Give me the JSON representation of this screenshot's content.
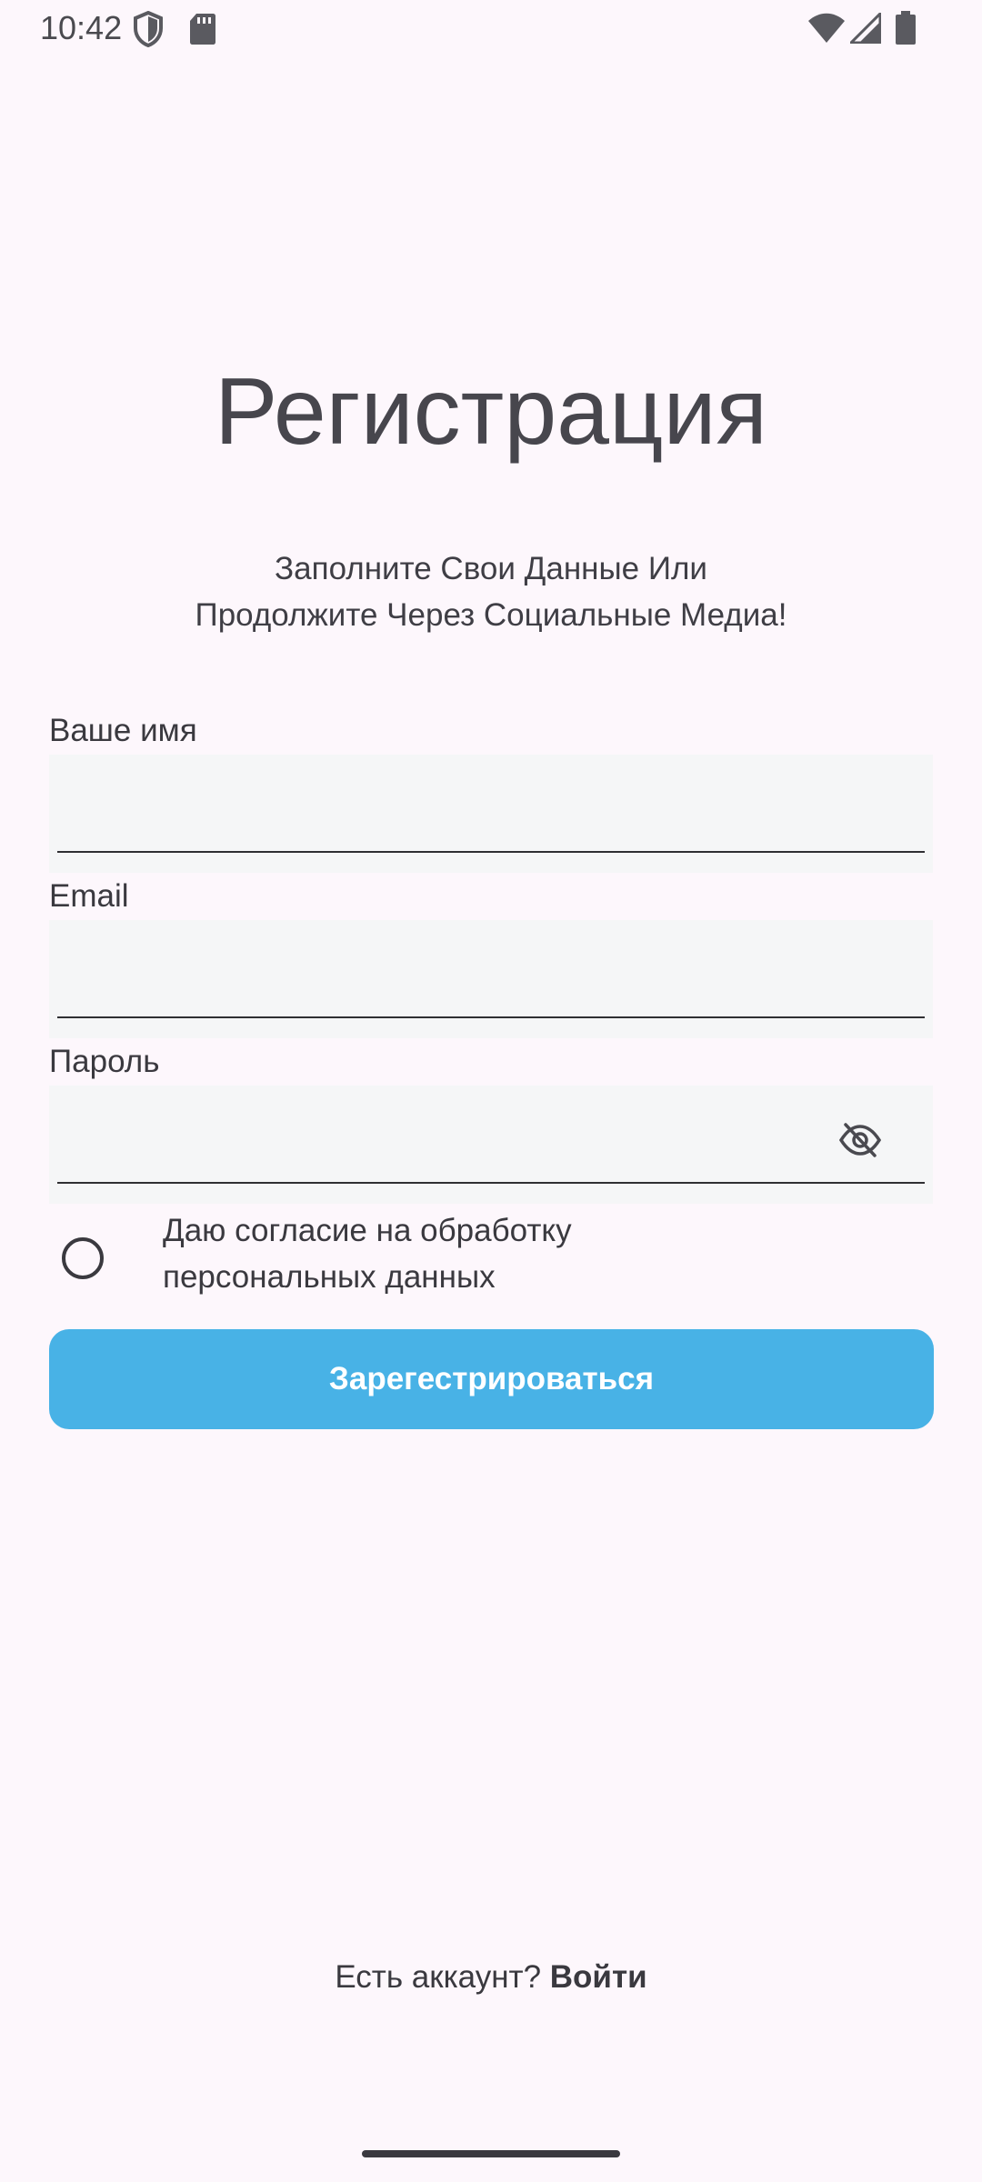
{
  "status_bar": {
    "time": "10:42",
    "icons": [
      "shield-icon",
      "sdcard-icon",
      "wifi-icon",
      "signal-icon",
      "battery-icon"
    ]
  },
  "header": {
    "title": "Регистрация",
    "subtitle_line1": "Заполните Свои Данные Или",
    "subtitle_line2": "Продолжите Через Социальные Медиа!"
  },
  "form": {
    "name": {
      "label": "Ваше имя",
      "value": ""
    },
    "email": {
      "label": "Email",
      "value": ""
    },
    "password": {
      "label": "Пароль",
      "value": "",
      "toggle_icon": "eye-off-icon"
    },
    "consent": {
      "line1": "Даю согласие на обработку",
      "line2": "персональных данных",
      "checked": false
    },
    "submit_label": "Зарегестрироваться"
  },
  "footer": {
    "prompt": "Есть аккаунт? ",
    "link": "Войти"
  },
  "colors": {
    "background": "#fdf7fc",
    "field_background": "#f5f6f7",
    "accent": "#48b2e6",
    "text": "#3a393f"
  }
}
